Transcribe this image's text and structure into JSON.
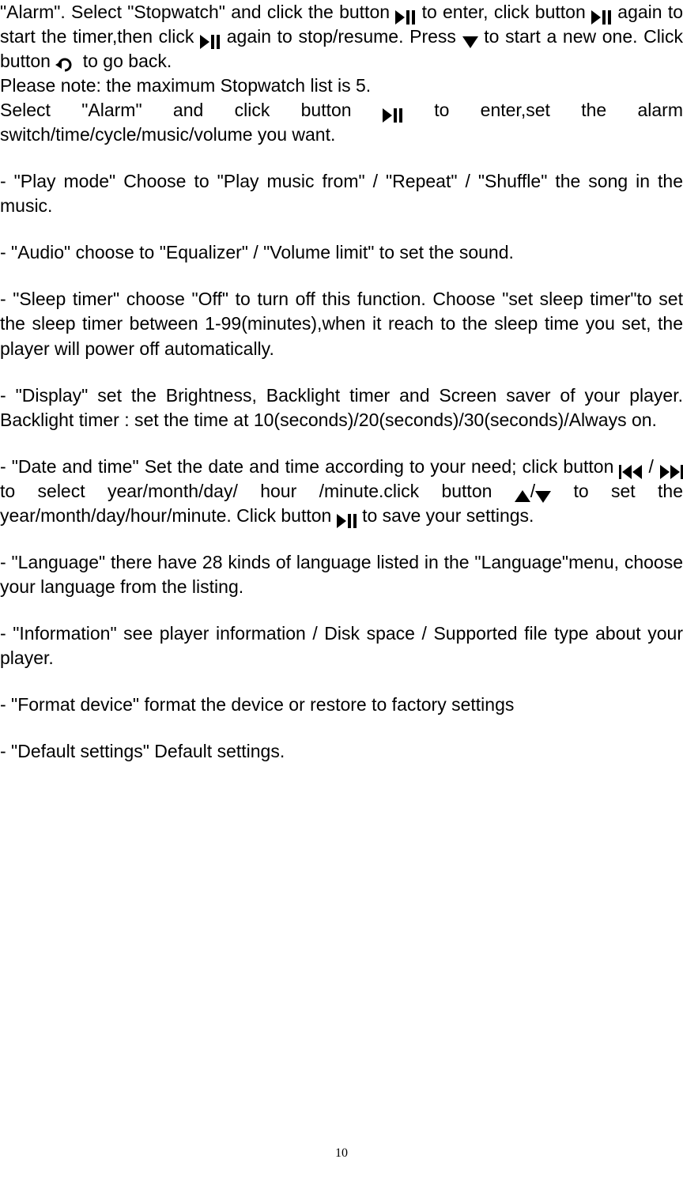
{
  "body": {
    "p1a": "\"Alarm\".  Select \"Stopwatch\" and click the button ",
    "p1b": " to enter, click button ",
    "p1c": " again to start the timer,then click ",
    "p1d": " again to stop/resume. Press ",
    "p1e": " to start a new one. Click button ",
    "p1f": " to go back.",
    "p2": "Please note: the maximum Stopwatch list is 5.",
    "p3a": "Select \"Alarm\" and click button ",
    "p3b": " to enter,set the alarm switch/time/cycle/music/volume you want.",
    "p_playmode": "- \"Play mode\"  Choose to \"Play music from\" / \"Repeat\" / \"Shuffle\" the song in the music.",
    "p_audio": "- \"Audio\" choose to \"Equalizer\" / \"Volume limit\" to set the sound.",
    "p_sleep": "- \"Sleep timer\"  choose \"Off\" to turn off this function. Choose \"set sleep timer\"to set the sleep timer between 1-99(minutes),when it reach to the sleep time you set, the player will power off automatically.",
    "p_display": "- \"Display\"  set the Brightness, Backlight timer and Screen saver of your player. Backlight timer : set the time at 10(seconds)/20(seconds)/30(seconds)/Always on.",
    "p_date_a": "- \"Date and time\"  Set the date and time according to your need; click button",
    "p_date_b": "/  ",
    "p_date_c": "  to select year/month/day/ hour /minute.click button  ",
    "p_date_d": "/",
    "p_date_e": " to set the year/month/day/hour/minute. Click button ",
    "p_date_f": " to save your settings.",
    "p_language": "- \"Language\" there have 28 kinds of language listed in the \"Language\"menu, choose your language from the listing.",
    "p_info": "- \"Information\" see player information / Disk space / Supported file type about your player.",
    "p_format": "- \"Format device\"  format the device or restore to factory settings",
    "p_default": "- \"Default settings\"  Default settings."
  },
  "page_number": "10"
}
